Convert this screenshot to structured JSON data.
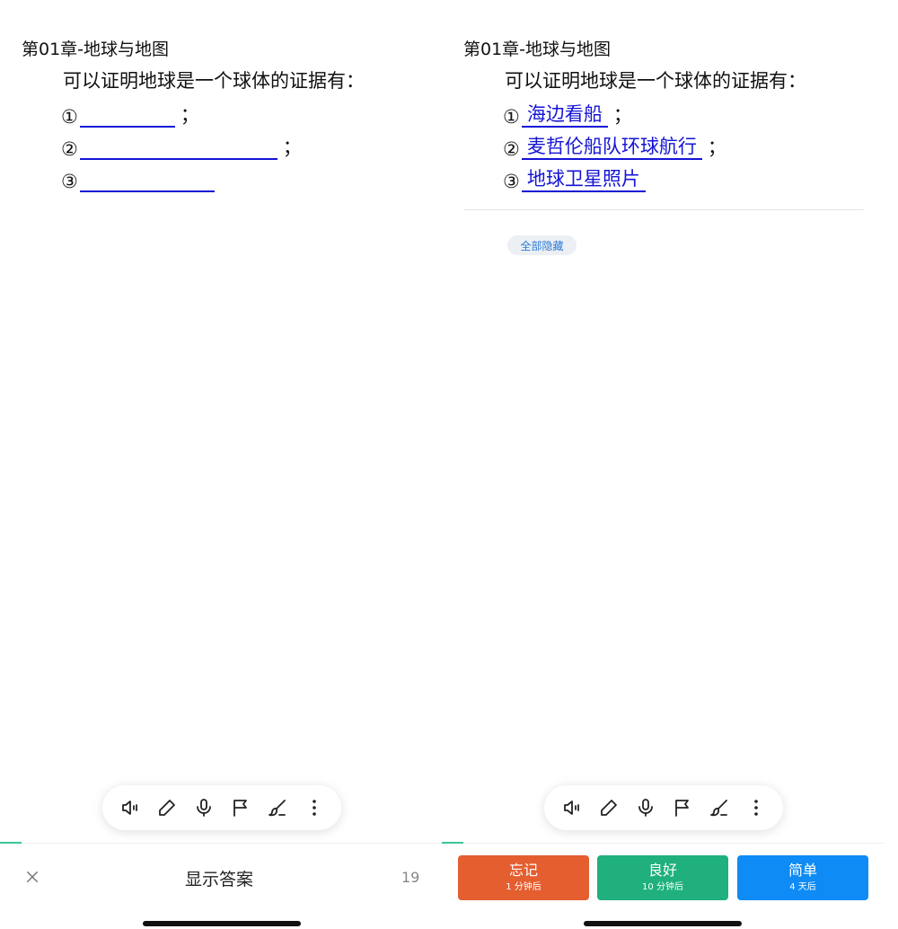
{
  "left": {
    "chapter": "第01章-地球与地图",
    "question": "可以证明地球是一个球体的证据有：",
    "items": [
      {
        "num": "①",
        "suffix": "；"
      },
      {
        "num": "②",
        "suffix": "；"
      },
      {
        "num": "③",
        "suffix": ""
      }
    ],
    "bottom": {
      "close_icon": "close-icon",
      "show_answer_label": "显示答案",
      "count": "19"
    }
  },
  "right": {
    "chapter": "第01章-地球与地图",
    "question": "可以证明地球是一个球体的证据有：",
    "items": [
      {
        "num": "①",
        "answer": "海边看船",
        "suffix": "；"
      },
      {
        "num": "②",
        "answer": "麦哲伦船队环球航行",
        "suffix": "；"
      },
      {
        "num": "③",
        "answer": "地球卫星照片",
        "suffix": ""
      }
    ],
    "hide_all_label": "全部隐藏",
    "grades": [
      {
        "label": "忘记",
        "interval": "1 分钟后",
        "color": "#e45e30"
      },
      {
        "label": "良好",
        "interval": "10 分钟后",
        "color": "#1fb07d"
      },
      {
        "label": "简单",
        "interval": "4 天后",
        "color": "#0e8bf5"
      }
    ]
  },
  "toolbar": {
    "icons": [
      "speaker-icon",
      "pencil-icon",
      "microphone-icon",
      "flag-icon",
      "brush-icon",
      "more-icon"
    ]
  },
  "colors": {
    "answer_blue": "#1414d6",
    "accent_green": "#3cc59a",
    "hide_all_text": "#2b7bd6"
  }
}
